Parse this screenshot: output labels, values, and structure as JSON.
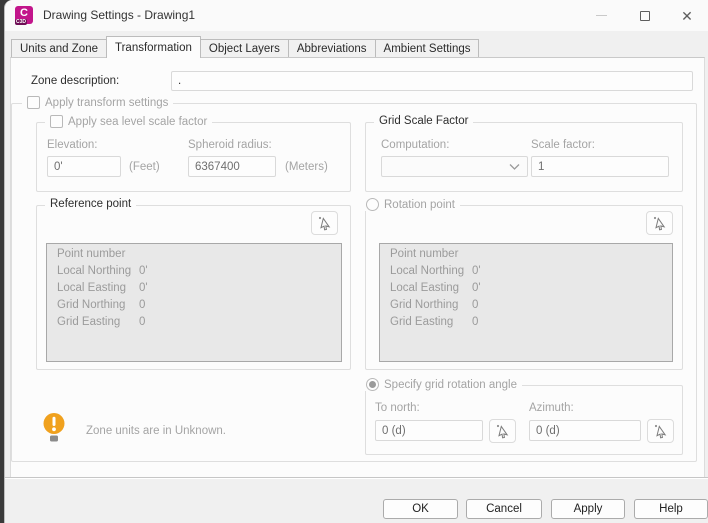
{
  "window": {
    "title": "Drawing Settings - Drawing1",
    "app_icon": {
      "name": "civil3d-icon",
      "letter": "C",
      "badge": "C3D"
    }
  },
  "icons": {
    "app": "civil3d-icon",
    "minimize": "minimize-icon",
    "maximize": "maximize-icon",
    "close": "close-icon",
    "pick": "pick-point-cursor-icon",
    "dropdown": "chevron-down-icon",
    "warning": "lightbulb-warning-icon"
  },
  "tabs": [
    {
      "label": "Units and Zone",
      "active": false
    },
    {
      "label": "Transformation",
      "active": true
    },
    {
      "label": "Object Layers",
      "active": false
    },
    {
      "label": "Abbreviations",
      "active": false
    },
    {
      "label": "Ambient Settings",
      "active": false
    }
  ],
  "zone_description": {
    "label": "Zone description:",
    "value": "."
  },
  "apply_transform": {
    "label": "Apply transform settings",
    "checked": false
  },
  "sea_level": {
    "label": "Apply sea level scale factor",
    "checked": false,
    "elevation_label": "Elevation:",
    "elevation_value": "0'",
    "elevation_unit": "(Feet)",
    "spheroid_label": "Spheroid radius:",
    "spheroid_value": "6367400",
    "spheroid_unit": "(Meters)"
  },
  "grid_scale": {
    "label": "Grid Scale Factor",
    "computation_label": "Computation:",
    "computation_value": "",
    "scale_factor_label": "Scale factor:",
    "scale_factor_value": "1"
  },
  "reference_point": {
    "label": "Reference point",
    "rows": [
      {
        "label": "Point number",
        "value": ""
      },
      {
        "label": "Local Northing",
        "value": "0'"
      },
      {
        "label": "Local Easting",
        "value": "0'"
      },
      {
        "label": "Grid Northing",
        "value": "0"
      },
      {
        "label": "Grid Easting",
        "value": "0"
      }
    ]
  },
  "rotation_point": {
    "label": "Rotation point",
    "selected": false,
    "rows": [
      {
        "label": "Point number",
        "value": ""
      },
      {
        "label": "Local Northing",
        "value": "0'"
      },
      {
        "label": "Local Easting",
        "value": "0'"
      },
      {
        "label": "Grid Northing",
        "value": "0"
      },
      {
        "label": "Grid Easting",
        "value": "0"
      }
    ]
  },
  "rotation_angle": {
    "label": "Specify grid rotation angle",
    "selected": true,
    "to_north_label": "To north:",
    "to_north_value": "0 (d)",
    "azimuth_label": "Azimuth:",
    "azimuth_value": "0 (d)"
  },
  "status": {
    "message": "Zone units are in Unknown."
  },
  "buttons": [
    "OK",
    "Cancel",
    "Apply",
    "Help"
  ],
  "colors": {
    "brand_magenta": "#c2158b",
    "warning_orange": "#f0a11e",
    "disabled_text": "#a4a4a4"
  }
}
